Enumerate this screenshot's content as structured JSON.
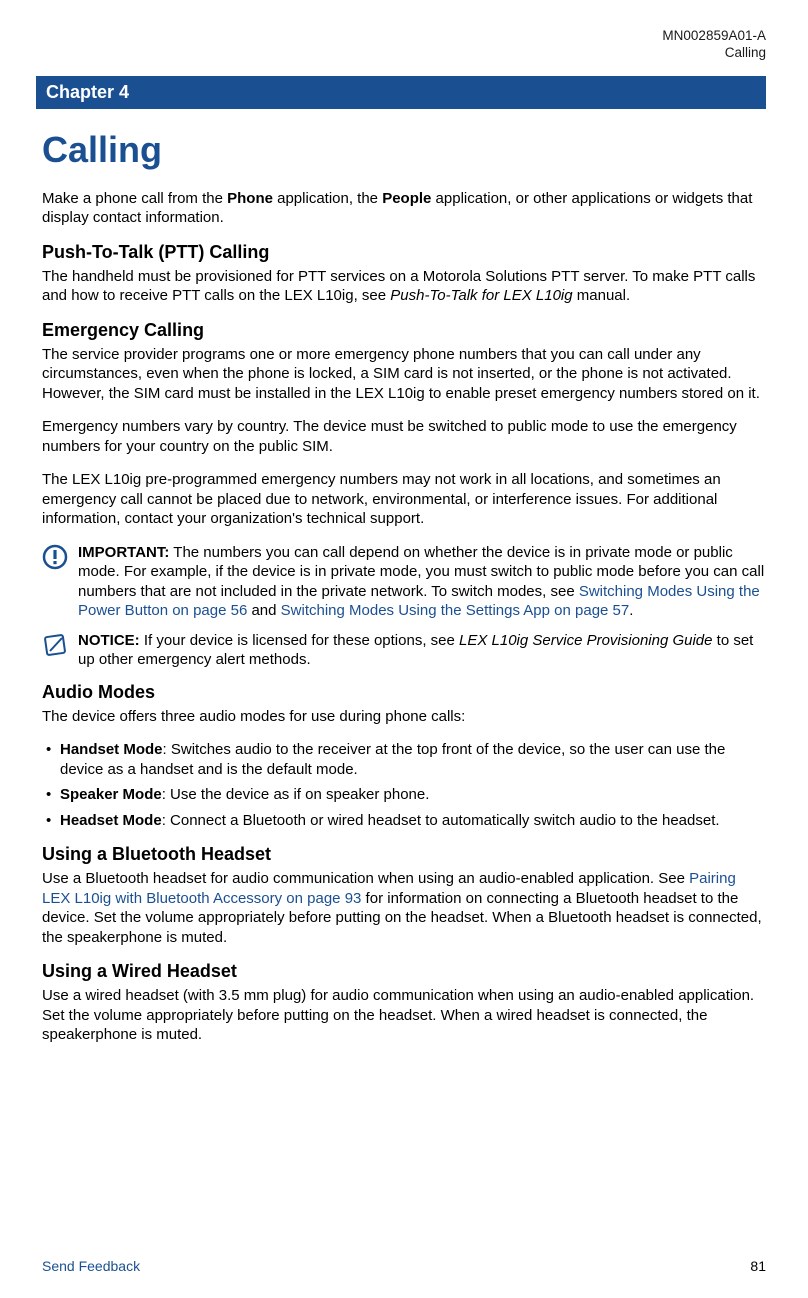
{
  "header": {
    "doc_id": "MN002859A01-A",
    "section": "Calling"
  },
  "chapter_banner": "Chapter 4",
  "title": "Calling",
  "intro": {
    "pre": "Make a phone call from the ",
    "bold1": "Phone",
    "mid": " application, the ",
    "bold2": "People",
    "post": " application, or other applications or widgets that display contact information."
  },
  "ptt": {
    "heading": "Push-To-Talk (PTT) Calling",
    "p_pre": "The handheld must be provisioned for PTT services on a Motorola Solutions PTT server. To make PTT calls and how to receive PTT calls on the LEX L10ig, see ",
    "p_italic": "Push-To-Talk for LEX L10ig",
    "p_post": " manual."
  },
  "emergency": {
    "heading": "Emergency Calling",
    "p1": "The service provider programs one or more emergency phone numbers that you can call under any circumstances, even when the phone is locked, a SIM card is not inserted, or the phone is not activated. However, the SIM card must be installed in the LEX L10ig to enable preset emergency numbers stored on it.",
    "p2": "Emergency numbers vary by country. The device must be switched to public mode to use the emergency numbers for your country on the public SIM.",
    "p3": "The LEX L10ig pre-programmed emergency numbers may not work in all locations, and sometimes an emergency call cannot be placed due to network, environmental, or interference issues. For additional information, contact your organization's technical support."
  },
  "important": {
    "label": "IMPORTANT:",
    "pre": " The numbers you can call depend on whether the device is in private mode or public mode. For example, if the device is in private mode, you must switch to public mode before you can call numbers that are not included in the private network. To switch modes, see ",
    "link1": "Switching Modes Using the Power Button on page 56",
    "mid": " and ",
    "link2": "Switching Modes Using the Settings App on page 57",
    "post": "."
  },
  "notice": {
    "label": "NOTICE:",
    "pre": " If your device is licensed for these options, see ",
    "italic": "LEX L10ig Service Provisioning Guide",
    "post": " to set up other emergency alert methods."
  },
  "audio": {
    "heading": "Audio Modes",
    "intro": "The device offers three audio modes for use during phone calls:",
    "items": [
      {
        "name": "Handset Mode",
        "desc": ": Switches audio to the receiver at the top front of the device, so the user can use the device as a handset and is the default mode."
      },
      {
        "name": "Speaker Mode",
        "desc": ": Use the device as if on speaker phone."
      },
      {
        "name": "Headset Mode",
        "desc": ": Connect a Bluetooth or wired headset to automatically switch audio to the headset."
      }
    ]
  },
  "bt": {
    "heading": "Using a Bluetooth Headset",
    "pre": "Use a Bluetooth headset for audio communication when using an audio-enabled application. See ",
    "link": "Pairing LEX L10ig with Bluetooth Accessory on page 93",
    "post": " for information on connecting a Bluetooth headset to the device. Set the volume appropriately before putting on the headset. When a Bluetooth headset is connected, the speakerphone is muted."
  },
  "wired": {
    "heading": "Using a Wired Headset",
    "p": "Use a wired headset (with 3.5 mm plug) for audio communication when using an audio-enabled application. Set the volume appropriately before putting on the headset. When a wired headset is connected, the speakerphone is muted."
  },
  "footer": {
    "feedback": "Send Feedback",
    "page": "81"
  }
}
